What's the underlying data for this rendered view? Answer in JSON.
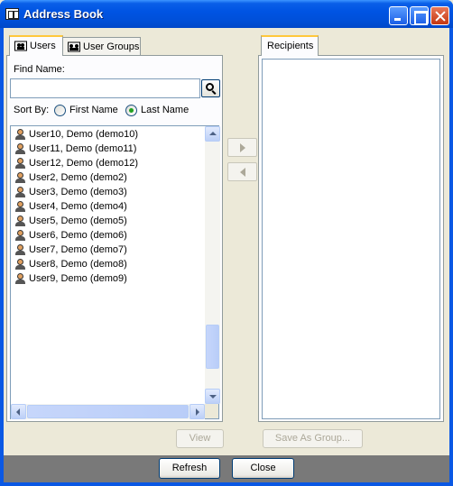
{
  "window": {
    "title": "Address Book"
  },
  "tabs": [
    {
      "label": "Users",
      "active": true
    },
    {
      "label": "User Groups",
      "active": false
    }
  ],
  "find": {
    "label": "Find Name:",
    "value": "",
    "placeholder": ""
  },
  "sort": {
    "label": "Sort By:",
    "options": [
      {
        "label": "First Name",
        "selected": false
      },
      {
        "label": "Last Name",
        "selected": true
      }
    ]
  },
  "users": [
    "User10, Demo (demo10)",
    "User11, Demo (demo11)",
    "User12, Demo (demo12)",
    "User2, Demo (demo2)",
    "User3, Demo (demo3)",
    "User4, Demo (demo4)",
    "User5, Demo (demo5)",
    "User6, Demo (demo6)",
    "User7, Demo (demo7)",
    "User8, Demo (demo8)",
    "User9, Demo (demo9)"
  ],
  "recipients": {
    "tab_label": "Recipients",
    "items": []
  },
  "buttons": {
    "view": "View",
    "save_as_group": "Save As Group...",
    "refresh": "Refresh",
    "close": "Close"
  },
  "icons": {
    "title": "address-book-icon",
    "tab_users": "users-icon",
    "tab_groups": "user-groups-icon",
    "search": "magnifier-icon",
    "user": "user-icon",
    "add": "arrow-right-icon",
    "remove": "arrow-left-icon"
  }
}
